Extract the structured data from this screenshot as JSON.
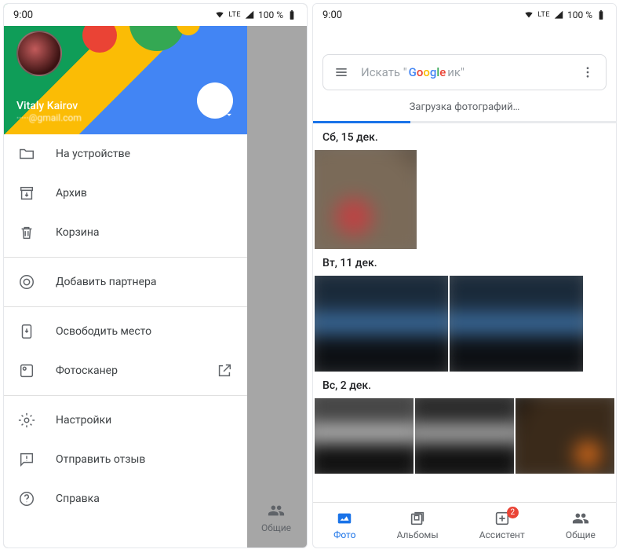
{
  "status": {
    "time": "9:00",
    "net": "LTE",
    "battery": "100 %"
  },
  "account": {
    "name": "Vitaly Kairov",
    "email": "·····@gmail.com"
  },
  "drawer": {
    "items": [
      {
        "icon": "folder",
        "label": "На устройстве"
      },
      {
        "icon": "archive",
        "label": "Архив"
      },
      {
        "icon": "trash",
        "label": "Корзина"
      },
      {
        "divider": true
      },
      {
        "icon": "partner",
        "label": "Добавить партнера"
      },
      {
        "divider": true
      },
      {
        "icon": "free",
        "label": "Освободить место"
      },
      {
        "icon": "scan",
        "label": "Фотосканер",
        "trail": "external"
      },
      {
        "divider": true
      },
      {
        "icon": "settings",
        "label": "Настройки"
      },
      {
        "icon": "feedback",
        "label": "Отправить отзыв"
      },
      {
        "icon": "help",
        "label": "Справка"
      }
    ]
  },
  "ghost_tab": "Общие",
  "search": {
    "prefix": "Искать \"",
    "suffix": "ик\""
  },
  "upload_status": "Загрузка фотографий…",
  "sections": [
    {
      "date": "Сб, 15 дек."
    },
    {
      "date": "Вт, 11 дек."
    },
    {
      "date": "Вс, 2 дек."
    }
  ],
  "bottom_nav": {
    "photos": "Фото",
    "albums": "Альбомы",
    "assistant": "Ассистент",
    "assistant_badge": "2",
    "shared": "Общие"
  }
}
